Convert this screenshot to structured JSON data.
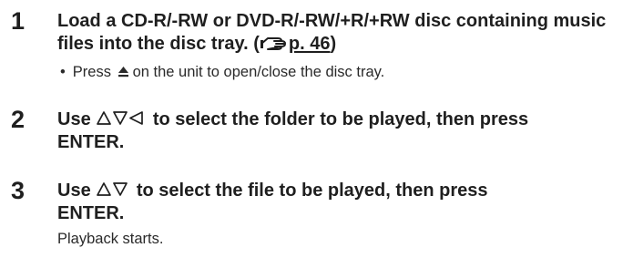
{
  "steps": [
    {
      "number": "1",
      "title_main": "Load a CD-R/-RW or DVD-R/-RW/+R/+RW disc containing music files into the disc tray. (",
      "ref_page": "p. 46",
      "title_close": ")",
      "ref_icon": "page-reference-hand-icon",
      "bullet": {
        "before": "Press",
        "icon": "eject-icon",
        "after": "on the unit to open/close the disc tray."
      }
    },
    {
      "number": "2",
      "title_before": "Use",
      "arrow_icons": [
        "up-triangle-icon",
        "down-triangle-icon",
        "left-triangle-icon"
      ],
      "title_after": "to select the folder to be played, then press",
      "title_line2": "ENTER."
    },
    {
      "number": "3",
      "title_before": "Use",
      "arrow_icons": [
        "up-triangle-icon",
        "down-triangle-icon"
      ],
      "title_after": "to select the file to be played, then press",
      "title_line2": "ENTER.",
      "note": "Playback starts."
    }
  ]
}
